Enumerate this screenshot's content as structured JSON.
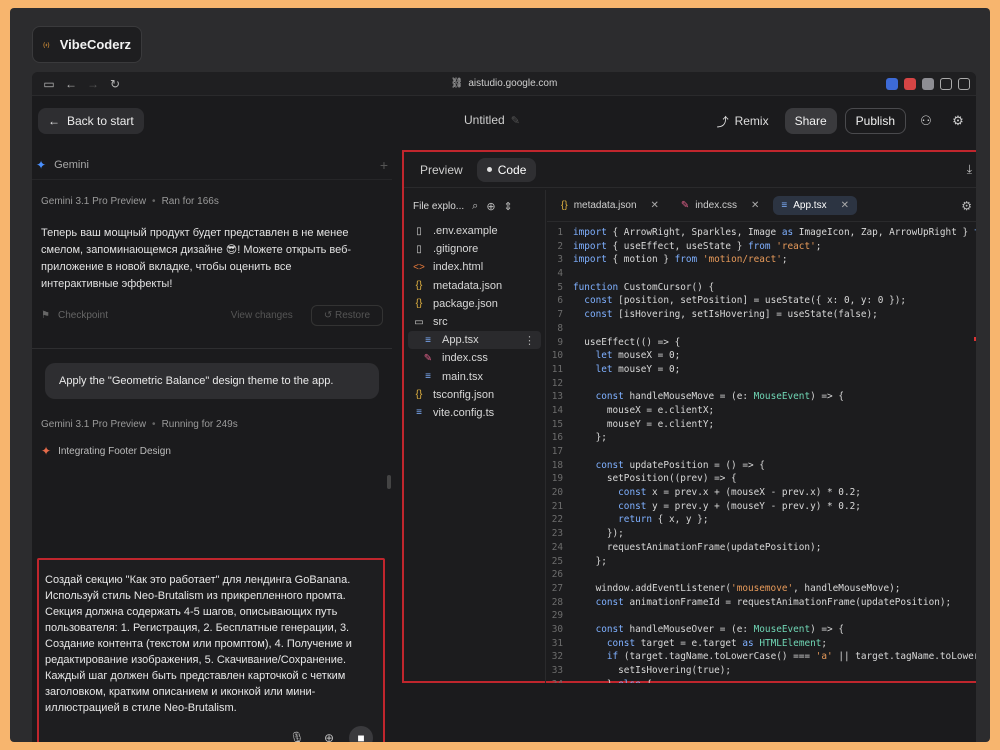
{
  "brand": {
    "name": "VibeCoderz",
    "accent": "#f0a13c"
  },
  "browser": {
    "url": "aistudio.google.com"
  },
  "appbar": {
    "back_label": "Back to start",
    "title": "Untitled",
    "remix_label": "Remix",
    "share_label": "Share",
    "publish_label": "Publish"
  },
  "chat": {
    "model_header": "Gemini",
    "run1": {
      "model": "Gemini 3.1 Pro Preview",
      "status": "Ran for 166s"
    },
    "message": "Теперь ваш мощный продукт будет представлен в не менее смелом, запоминающемся дизайне 😎! Можете открыть веб-приложение в новой вкладке, чтобы оценить все интерактивные эффекты!",
    "checkpoint_label": "Checkpoint",
    "view_changes_label": "View changes",
    "restore_label": "Restore",
    "user_prompt": "Apply the \"Geometric Balance\" design theme to the app.",
    "run2": {
      "model": "Gemini 3.1 Pro Preview",
      "status": "Running for 249s"
    },
    "thinking": "Integrating Footer Design",
    "composer_text": "Создай секцию \"Как это работает\" для лендинга GoBanana. Используй стиль Neo-Brutalism из прикрепленного промта. Секция должна содержать 4-5 шагов, описывающих путь пользователя: 1. Регистрация, 2. Бесплатные генерации, 3. Создание контента (текстом или промптом), 4. Получение и редактирование изображения, 5. Скачивание/Сохранение. Каждый шаг должен быть представлен карточкой с четким заголовком, кратким описанием и иконкой или мини-иллюстрацией в стиле Neo-Brutalism."
  },
  "ide": {
    "tabs": [
      "Preview",
      "Code"
    ],
    "active_tab": "Code",
    "explorer_title": "File explo...",
    "files": [
      {
        "name": ".env.example",
        "icon": "file-icon"
      },
      {
        "name": ".gitignore",
        "icon": "file-icon"
      },
      {
        "name": "index.html",
        "icon": "html-icon"
      },
      {
        "name": "metadata.json",
        "icon": "json-icon"
      },
      {
        "name": "package.json",
        "icon": "json-icon"
      },
      {
        "name": "src",
        "icon": "folder-icon"
      },
      {
        "name": "App.tsx",
        "icon": "tsx-icon"
      },
      {
        "name": "index.css",
        "icon": "css-icon"
      },
      {
        "name": "main.tsx",
        "icon": "tsx-icon"
      },
      {
        "name": "tsconfig.json",
        "icon": "json-icon"
      },
      {
        "name": "vite.config.ts",
        "icon": "ts-icon"
      }
    ],
    "editor_tabs": [
      "metadata.json",
      "index.css",
      "App.tsx"
    ],
    "active_editor_tab": "App.tsx"
  },
  "code_lines": [
    "import { ArrowRight, Sparkles, Image as ImageIcon, Zap, ArrowUpRight } from",
    "import { useEffect, useState } from 'react';",
    "import { motion } from 'motion/react';",
    "",
    "function CustomCursor() {",
    "  const [position, setPosition] = useState({ x: 0, y: 0 });",
    "  const [isHovering, setIsHovering] = useState(false);",
    "",
    "  useEffect(() => {",
    "    let mouseX = 0;",
    "    let mouseY = 0;",
    "",
    "    const handleMouseMove = (e: MouseEvent) => {",
    "      mouseX = e.clientX;",
    "      mouseY = e.clientY;",
    "    };",
    "",
    "    const updatePosition = () => {",
    "      setPosition((prev) => {",
    "        const x = prev.x + (mouseX - prev.x) * 0.2;",
    "        const y = prev.y + (mouseY - prev.y) * 0.2;",
    "        return { x, y };",
    "      });",
    "      requestAnimationFrame(updatePosition);",
    "    };",
    "",
    "    window.addEventListener('mousemove', handleMouseMove);",
    "    const animationFrameId = requestAnimationFrame(updatePosition);",
    "",
    "    const handleMouseOver = (e: MouseEvent) => {",
    "      const target = e.target as HTMLElement;",
    "      if (target.tagName.toLowerCase() === 'a' || target.tagName.toLowerCas",
    "        setIsHovering(true);",
    "      } else {"
  ]
}
